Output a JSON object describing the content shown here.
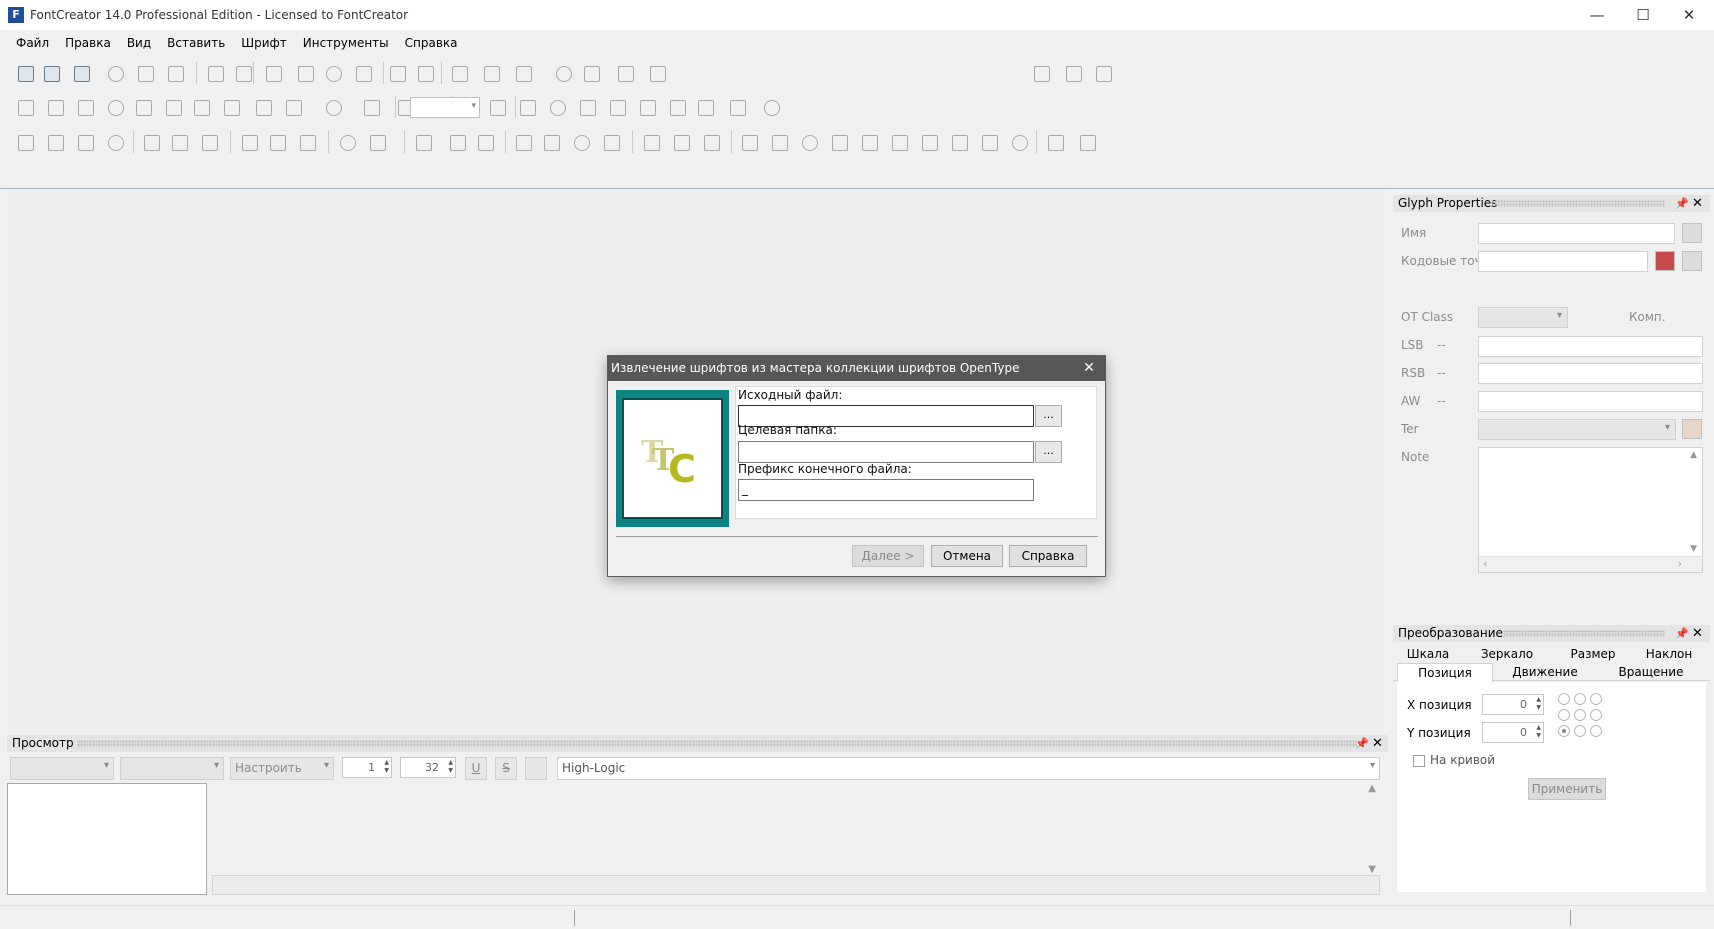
{
  "titlebar": {
    "title": "FontCreator 14.0 Professional Edition - Licensed to FontCreator",
    "app_icon": "fontcreator-icon",
    "minimize": "—",
    "maximize": "☐",
    "close": "✕"
  },
  "menu": [
    "Файл",
    "Правка",
    "Вид",
    "Вставить",
    "Шрифт",
    "Инструменты",
    "Справка"
  ],
  "glyph_properties": {
    "title": "Glyph Properties",
    "name_label": "Имя",
    "codepoints_label": "Кодовые точк",
    "otclass_label": "OT Class",
    "komp_label": "Комп.",
    "lsb_label": "LSB",
    "rsb_label": "RSB",
    "aw_label": "AW",
    "tag_label": "Ter",
    "note_label": "Note",
    "dash": "--"
  },
  "transform": {
    "title": "Преобразование",
    "tabs_row1": [
      "Шкала",
      "Зеркало",
      "Размер",
      "Наклон"
    ],
    "tabs_row2": [
      "Позиция",
      "Движение",
      "Вращение"
    ],
    "x_label": "X позиция",
    "y_label": "Y позиция",
    "x_value": "0",
    "y_value": "0",
    "on_curve_label": "На кривой",
    "apply_label": "Применить"
  },
  "preview": {
    "title": "Просмотр",
    "fit_label": "Настроить",
    "size_value": "1",
    "size2_value": "32",
    "underline": "U",
    "strike": "S",
    "text_value": "High-Logic"
  },
  "dialog": {
    "title": "Извлечение шрифтов из мастера коллекции шрифтов OpenType",
    "source_label": "Исходный файл:",
    "target_label": "Целевая папка:",
    "prefix_label": "Префикс конечного файла:",
    "source_value": "",
    "target_value": "",
    "prefix_value": "_",
    "browse_label": "...",
    "next_label": "Далее >",
    "cancel_label": "Отмена",
    "help_label": "Справка",
    "logo_text": "TTC"
  }
}
